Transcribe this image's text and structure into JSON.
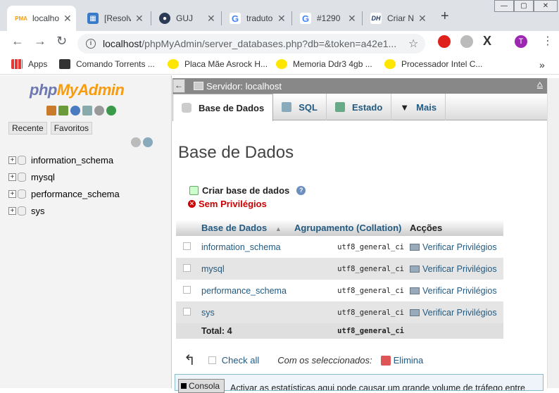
{
  "browser": {
    "tabs": [
      {
        "title": "localhost",
        "favicon": "pma-icon",
        "color": "#f89c0e",
        "active": true
      },
      {
        "title": "[Resolvido]",
        "favicon": "cube-icon",
        "color": "#3a7bc8",
        "active": false
      },
      {
        "title": "GUJ",
        "favicon": "guj-icon",
        "color": "#2b3a55",
        "active": false
      },
      {
        "title": "tradutor",
        "favicon": "google-icon",
        "color": "#4285f4",
        "active": false
      },
      {
        "title": "#1290",
        "favicon": "google-icon",
        "color": "#4285f4",
        "active": false
      },
      {
        "title": "Criar No",
        "favicon": "dh-icon",
        "color": "#203a66",
        "active": false
      }
    ],
    "new_tab": "+",
    "window_buttons": [
      "—",
      "▢",
      "✕"
    ],
    "url_host": "localhost",
    "url_rest": "/phpMyAdmin/server_databases.php?db=&token=a42e1...",
    "profile_initial": "T",
    "bookmarks": [
      {
        "label": "Apps",
        "icon": "apps-icon"
      },
      {
        "label": "Comando Torrents ...",
        "icon": "torrent-icon"
      },
      {
        "label": "Placa Mãe Asrock H...",
        "icon": "ml-icon"
      },
      {
        "label": "Memoria Ddr3 4gb ...",
        "icon": "ml-icon"
      },
      {
        "label": "Processador Intel C...",
        "icon": "ml-icon"
      }
    ],
    "bookmarks_more": "»"
  },
  "sidebar": {
    "logo_php": "php",
    "logo_myadmin": "MyAdmin",
    "tab_recent": "Recente",
    "tab_favorites": "Favoritos",
    "databases": [
      "information_schema",
      "mysql",
      "performance_schema",
      "sys"
    ]
  },
  "main": {
    "server_label": "Servidor: localhost",
    "tabs": [
      {
        "label": "Base de Dados",
        "icon": "database-icon"
      },
      {
        "label": "SQL",
        "icon": "sql-icon"
      },
      {
        "label": "Estado",
        "icon": "status-icon"
      },
      {
        "label": "Mais",
        "icon": "caret-down-icon"
      }
    ],
    "heading": "Base de Dados",
    "create_db": "Criar base de dados",
    "no_privileges": "Sem Privilégios",
    "table": {
      "headers": [
        "Base de Dados",
        "Agrupamento (Collation)",
        "Acções"
      ],
      "rows": [
        {
          "name": "information_schema",
          "collation": "utf8_general_ci",
          "action": "Verificar Privilégios"
        },
        {
          "name": "mysql",
          "collation": "utf8_general_ci",
          "action": "Verificar Privilégios"
        },
        {
          "name": "performance_schema",
          "collation": "utf8_general_ci",
          "action": "Verificar Privilégios"
        },
        {
          "name": "sys",
          "collation": "utf8_general_ci",
          "action": "Verificar Privilégios"
        }
      ],
      "total_label": "Total: 4",
      "total_collation": "utf8_general_ci"
    },
    "check_all": "Check all",
    "with_selected": "Com os seleccionados:",
    "drop": "Elimina",
    "notice_text": "Activar as estatísticas aqui pode causar um grande volume de tráfego entre",
    "console": "Consola"
  }
}
